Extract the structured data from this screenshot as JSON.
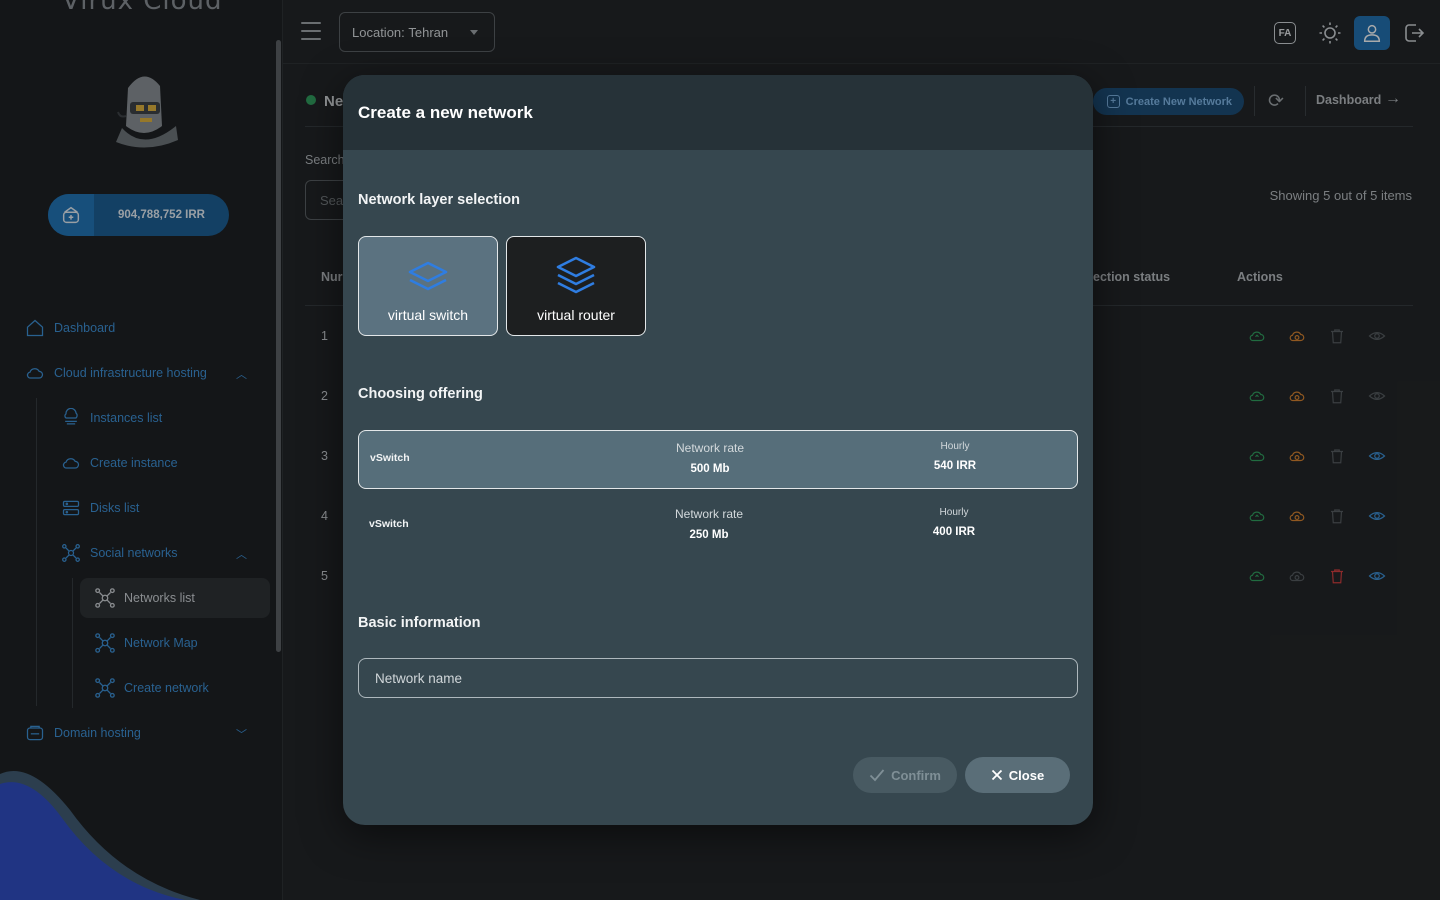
{
  "app": {
    "brand": "Virux Cloud"
  },
  "wallet": {
    "amount": "904,788,752 IRR"
  },
  "sidebar": {
    "items": [
      {
        "label": "Dashboard"
      },
      {
        "label": "Cloud infrastructure hosting"
      },
      {
        "label": "Instances list"
      },
      {
        "label": "Create instance"
      },
      {
        "label": "Disks list"
      },
      {
        "label": "Social networks"
      },
      {
        "label": "Networks list"
      },
      {
        "label": "Network Map"
      },
      {
        "label": "Create network"
      },
      {
        "label": "Domain hosting"
      }
    ]
  },
  "topbar": {
    "location_label": "Location:",
    "location_value": "Tehran",
    "lang_badge": "FA"
  },
  "main": {
    "title": "Ne",
    "create_button": "Create New Network",
    "dashboard_link": "Dashboard",
    "search_label": "Search",
    "search_placeholder": "Sea",
    "showing": "Showing 5 out of 5 items",
    "columns": {
      "num": "Nur",
      "status": "ection status",
      "actions": "Actions"
    },
    "rows": [
      "1",
      "2",
      "3",
      "4",
      "5"
    ]
  },
  "modal": {
    "title": "Create a new network",
    "layer_section": "Network layer selection",
    "layers": [
      {
        "label": "virtual switch",
        "selected": true
      },
      {
        "label": "virtual router",
        "selected": false
      }
    ],
    "offering_section": "Choosing offering",
    "offerings": [
      {
        "name": "vSwitch",
        "rate_label": "Network rate",
        "rate": "500 Mb",
        "price_label": "Hourly",
        "price": "540 IRR",
        "selected": true
      },
      {
        "name": "vSwitch",
        "rate_label": "Network rate",
        "rate": "250 Mb",
        "price_label": "Hourly",
        "price": "400 IRR",
        "selected": false
      }
    ],
    "basic_section": "Basic information",
    "name_placeholder": "Network name",
    "confirm_label": "Confirm",
    "close_label": "Close"
  },
  "colors": {
    "accent": "#1f6fb0",
    "link": "#3b8fd6",
    "modal_bg": "#36474f",
    "modal_head": "#263238",
    "green": "#2e9e5b",
    "orange": "#d9822b",
    "red": "#d33b3b"
  },
  "icons": [
    "menu-icon",
    "caret-down-icon",
    "fa-lang-icon",
    "sun-icon",
    "user-icon",
    "logout-icon",
    "wallet-icon",
    "home-icon",
    "cloud-icon",
    "chevron-up-icon",
    "chevron-down-icon",
    "network-icon",
    "disk-icon",
    "layers-icon",
    "check-icon",
    "close-icon",
    "refresh-icon",
    "arrow-right-icon",
    "plus-icon",
    "eye-icon",
    "trash-icon",
    "cloud-action-icon"
  ]
}
